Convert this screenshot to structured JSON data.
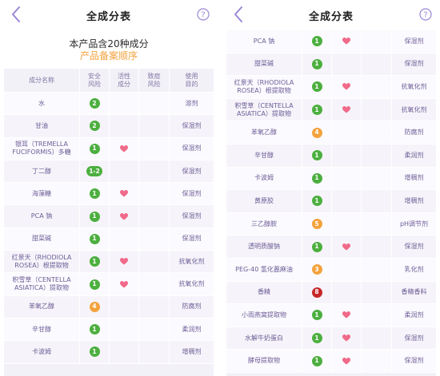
{
  "colors": {
    "green": "#4caf3f",
    "orange": "#f4a23d",
    "yellow": "#f4a23d",
    "red": "#c62828",
    "heart": "#f06a8a",
    "accent": "#9b86d6"
  },
  "left": {
    "title": "全成分表",
    "summary_line1": "本产品含20种成分",
    "summary_line2": "产品备案顺序",
    "headers": [
      "成分名称",
      "安全\n风险",
      "活性\n成分",
      "致痘\n风险",
      "使用\n目的"
    ],
    "rows": [
      {
        "name": "水",
        "safety": "2",
        "color": "green",
        "active": false,
        "use": "溶剂"
      },
      {
        "name": "甘油",
        "safety": "2",
        "color": "green",
        "active": false,
        "use": "保湿剂"
      },
      {
        "name": "银耳（TREMELLA FUCIFORMIS）多糖",
        "safety": "1",
        "color": "green",
        "active": true,
        "use": "保湿剂"
      },
      {
        "name": "丁二醇",
        "safety": "1-2",
        "color": "green",
        "active": false,
        "use": "保湿剂"
      },
      {
        "name": "海藻糖",
        "safety": "1",
        "color": "green",
        "active": true,
        "use": "保湿剂"
      },
      {
        "name": "PCA 钠",
        "safety": "1",
        "color": "green",
        "active": true,
        "use": "保湿剂"
      },
      {
        "name": "甜菜碱",
        "safety": "1",
        "color": "green",
        "active": false,
        "use": "保湿剂"
      },
      {
        "name": "红景天（RHODIOLA ROSEA）根提取物",
        "safety": "1",
        "color": "green",
        "active": true,
        "use": "抗氧化剂"
      },
      {
        "name": "积雪草（CENTELLA ASIATICA）提取物",
        "safety": "1",
        "color": "green",
        "active": true,
        "use": "抗氧化剂"
      },
      {
        "name": "苯氧乙醇",
        "safety": "4",
        "color": "orange",
        "active": false,
        "use": "防腐剂"
      },
      {
        "name": "辛甘醇",
        "safety": "1",
        "color": "green",
        "active": false,
        "use": "柔润剂"
      },
      {
        "name": "卡波姆",
        "safety": "1",
        "color": "green",
        "active": false,
        "use": "增稠剂"
      }
    ]
  },
  "right": {
    "title": "全成分表",
    "rows": [
      {
        "name": "PCA 钠",
        "safety": "1",
        "color": "green",
        "active": true,
        "use": "保湿剂"
      },
      {
        "name": "甜菜碱",
        "safety": "1",
        "color": "green",
        "active": false,
        "use": "保湿剂"
      },
      {
        "name": "红景天（RHODIOLA ROSEA）根提取物",
        "safety": "1",
        "color": "green",
        "active": true,
        "use": "抗氧化剂"
      },
      {
        "name": "积雪草（CENTELLA ASIATICA）提取物",
        "safety": "1",
        "color": "green",
        "active": true,
        "use": "抗氧化剂"
      },
      {
        "name": "苯氧乙醇",
        "safety": "4",
        "color": "orange",
        "active": false,
        "use": "防腐剂"
      },
      {
        "name": "辛甘醇",
        "safety": "1",
        "color": "green",
        "active": false,
        "use": "柔润剂"
      },
      {
        "name": "卡波姆",
        "safety": "1",
        "color": "green",
        "active": false,
        "use": "增稠剂"
      },
      {
        "name": "黄原胶",
        "safety": "1",
        "color": "green",
        "active": false,
        "use": "增稠剂"
      },
      {
        "name": "三乙醇胺",
        "safety": "5",
        "color": "yellow",
        "active": false,
        "use": "pH调节剂"
      },
      {
        "name": "透明质酸钠",
        "safety": "1",
        "color": "green",
        "active": true,
        "use": "保湿剂"
      },
      {
        "name": "PEG-40 氢化蓖麻油",
        "safety": "3",
        "color": "orange",
        "active": false,
        "use": "乳化剂"
      },
      {
        "name": "香精",
        "safety": "8",
        "color": "red",
        "active": false,
        "use": "香精香料"
      },
      {
        "name": "小雨燕窝提取物",
        "safety": "1",
        "color": "green",
        "active": true,
        "use": "柔润剂"
      },
      {
        "name": "水解牛奶蛋白",
        "safety": "1",
        "color": "green",
        "active": true,
        "use": "保湿剂"
      },
      {
        "name": "酵母提取物",
        "safety": "1",
        "color": "green",
        "active": true,
        "use": "保湿剂"
      }
    ]
  }
}
